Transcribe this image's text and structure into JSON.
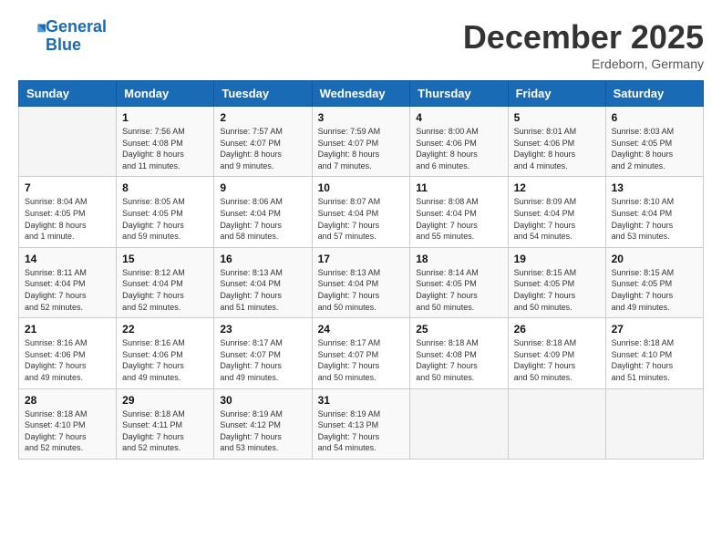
{
  "header": {
    "logo_line1": "General",
    "logo_line2": "Blue",
    "month": "December 2025",
    "location": "Erdeborn, Germany"
  },
  "weekdays": [
    "Sunday",
    "Monday",
    "Tuesday",
    "Wednesday",
    "Thursday",
    "Friday",
    "Saturday"
  ],
  "weeks": [
    [
      {
        "day": "",
        "info": ""
      },
      {
        "day": "1",
        "info": "Sunrise: 7:56 AM\nSunset: 4:08 PM\nDaylight: 8 hours\nand 11 minutes."
      },
      {
        "day": "2",
        "info": "Sunrise: 7:57 AM\nSunset: 4:07 PM\nDaylight: 8 hours\nand 9 minutes."
      },
      {
        "day": "3",
        "info": "Sunrise: 7:59 AM\nSunset: 4:07 PM\nDaylight: 8 hours\nand 7 minutes."
      },
      {
        "day": "4",
        "info": "Sunrise: 8:00 AM\nSunset: 4:06 PM\nDaylight: 8 hours\nand 6 minutes."
      },
      {
        "day": "5",
        "info": "Sunrise: 8:01 AM\nSunset: 4:06 PM\nDaylight: 8 hours\nand 4 minutes."
      },
      {
        "day": "6",
        "info": "Sunrise: 8:03 AM\nSunset: 4:05 PM\nDaylight: 8 hours\nand 2 minutes."
      }
    ],
    [
      {
        "day": "7",
        "info": "Sunrise: 8:04 AM\nSunset: 4:05 PM\nDaylight: 8 hours\nand 1 minute."
      },
      {
        "day": "8",
        "info": "Sunrise: 8:05 AM\nSunset: 4:05 PM\nDaylight: 7 hours\nand 59 minutes."
      },
      {
        "day": "9",
        "info": "Sunrise: 8:06 AM\nSunset: 4:04 PM\nDaylight: 7 hours\nand 58 minutes."
      },
      {
        "day": "10",
        "info": "Sunrise: 8:07 AM\nSunset: 4:04 PM\nDaylight: 7 hours\nand 57 minutes."
      },
      {
        "day": "11",
        "info": "Sunrise: 8:08 AM\nSunset: 4:04 PM\nDaylight: 7 hours\nand 55 minutes."
      },
      {
        "day": "12",
        "info": "Sunrise: 8:09 AM\nSunset: 4:04 PM\nDaylight: 7 hours\nand 54 minutes."
      },
      {
        "day": "13",
        "info": "Sunrise: 8:10 AM\nSunset: 4:04 PM\nDaylight: 7 hours\nand 53 minutes."
      }
    ],
    [
      {
        "day": "14",
        "info": "Sunrise: 8:11 AM\nSunset: 4:04 PM\nDaylight: 7 hours\nand 52 minutes."
      },
      {
        "day": "15",
        "info": "Sunrise: 8:12 AM\nSunset: 4:04 PM\nDaylight: 7 hours\nand 52 minutes."
      },
      {
        "day": "16",
        "info": "Sunrise: 8:13 AM\nSunset: 4:04 PM\nDaylight: 7 hours\nand 51 minutes."
      },
      {
        "day": "17",
        "info": "Sunrise: 8:13 AM\nSunset: 4:04 PM\nDaylight: 7 hours\nand 50 minutes."
      },
      {
        "day": "18",
        "info": "Sunrise: 8:14 AM\nSunset: 4:05 PM\nDaylight: 7 hours\nand 50 minutes."
      },
      {
        "day": "19",
        "info": "Sunrise: 8:15 AM\nSunset: 4:05 PM\nDaylight: 7 hours\nand 50 minutes."
      },
      {
        "day": "20",
        "info": "Sunrise: 8:15 AM\nSunset: 4:05 PM\nDaylight: 7 hours\nand 49 minutes."
      }
    ],
    [
      {
        "day": "21",
        "info": "Sunrise: 8:16 AM\nSunset: 4:06 PM\nDaylight: 7 hours\nand 49 minutes."
      },
      {
        "day": "22",
        "info": "Sunrise: 8:16 AM\nSunset: 4:06 PM\nDaylight: 7 hours\nand 49 minutes."
      },
      {
        "day": "23",
        "info": "Sunrise: 8:17 AM\nSunset: 4:07 PM\nDaylight: 7 hours\nand 49 minutes."
      },
      {
        "day": "24",
        "info": "Sunrise: 8:17 AM\nSunset: 4:07 PM\nDaylight: 7 hours\nand 50 minutes."
      },
      {
        "day": "25",
        "info": "Sunrise: 8:18 AM\nSunset: 4:08 PM\nDaylight: 7 hours\nand 50 minutes."
      },
      {
        "day": "26",
        "info": "Sunrise: 8:18 AM\nSunset: 4:09 PM\nDaylight: 7 hours\nand 50 minutes."
      },
      {
        "day": "27",
        "info": "Sunrise: 8:18 AM\nSunset: 4:10 PM\nDaylight: 7 hours\nand 51 minutes."
      }
    ],
    [
      {
        "day": "28",
        "info": "Sunrise: 8:18 AM\nSunset: 4:10 PM\nDaylight: 7 hours\nand 52 minutes."
      },
      {
        "day": "29",
        "info": "Sunrise: 8:18 AM\nSunset: 4:11 PM\nDaylight: 7 hours\nand 52 minutes."
      },
      {
        "day": "30",
        "info": "Sunrise: 8:19 AM\nSunset: 4:12 PM\nDaylight: 7 hours\nand 53 minutes."
      },
      {
        "day": "31",
        "info": "Sunrise: 8:19 AM\nSunset: 4:13 PM\nDaylight: 7 hours\nand 54 minutes."
      },
      {
        "day": "",
        "info": ""
      },
      {
        "day": "",
        "info": ""
      },
      {
        "day": "",
        "info": ""
      }
    ]
  ]
}
